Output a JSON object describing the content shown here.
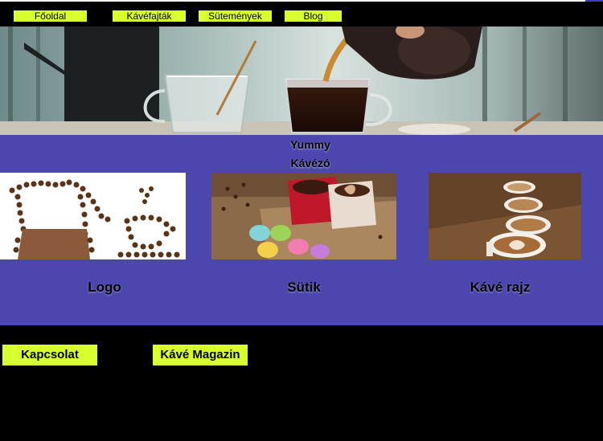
{
  "nav": {
    "items": [
      {
        "label": "Főoldal"
      },
      {
        "label": "Kávéfajták"
      },
      {
        "label": "Sütemények"
      },
      {
        "label": "Blog"
      }
    ]
  },
  "main": {
    "title_line1": "Yummy",
    "title_line2": "Kávézó",
    "cards": [
      {
        "label": "Logo"
      },
      {
        "label": "Sütik"
      },
      {
        "label": "Kávé rajz"
      }
    ]
  },
  "footer": {
    "links": [
      {
        "label": "Kapcsolat"
      },
      {
        "label": "Kávé Magazin"
      }
    ]
  },
  "colors": {
    "accent": "#d8ff2e",
    "main_bg": "#4b47ae",
    "page_bg": "#000000"
  }
}
